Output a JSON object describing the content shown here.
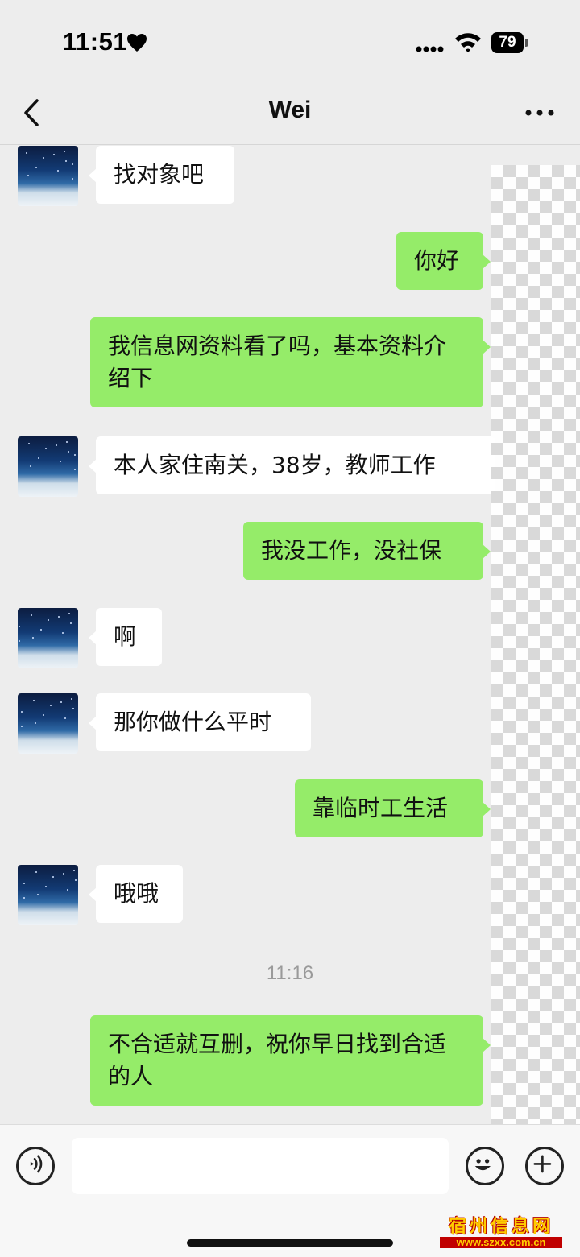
{
  "status_bar": {
    "time": "11:51",
    "battery": "79"
  },
  "nav": {
    "title": "Wei"
  },
  "messages": [
    {
      "side": "in",
      "text": "找对象吧"
    },
    {
      "side": "out",
      "text": "你好"
    },
    {
      "side": "out",
      "text": "我信息网资料看了吗，基本资料介绍下"
    },
    {
      "side": "in",
      "text": "本人家住南关，38岁，教师工作"
    },
    {
      "side": "out",
      "text": "我没工作，没社保"
    },
    {
      "side": "in",
      "text": "啊"
    },
    {
      "side": "in",
      "text": "那你做什么平时"
    },
    {
      "side": "out",
      "text": "靠临时工生活"
    },
    {
      "side": "in",
      "text": "哦哦"
    },
    {
      "side": "out",
      "text": "不合适就互删，祝你早日找到合适的人"
    }
  ],
  "timestamp": "11:16",
  "watermark": {
    "title": "宿州信息网",
    "url": "www.szxx.com.cn"
  },
  "colors": {
    "background": "#ededed",
    "incoming_bubble": "#ffffff",
    "outgoing_bubble": "#95ec69"
  },
  "icons": [
    "heart-icon",
    "signal-icon",
    "wifi-icon",
    "back-icon",
    "more-icon",
    "voice-icon",
    "emoji-icon",
    "plus-icon"
  ]
}
